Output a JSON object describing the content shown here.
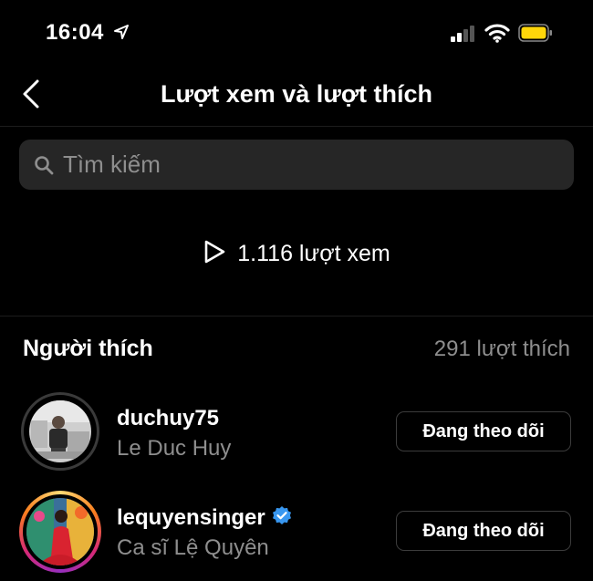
{
  "status_bar": {
    "time": "16:04"
  },
  "nav": {
    "title": "Lượt xem và lượt thích"
  },
  "search": {
    "placeholder": "Tìm kiếm"
  },
  "views": {
    "label": "1.116 lượt xem"
  },
  "likes": {
    "title": "Người thích",
    "count_label": "291 lượt thích"
  },
  "users": [
    {
      "username": "duchuy75",
      "full_name": "Le Duc Huy",
      "verified": false,
      "button_label": "Đang theo dõi"
    },
    {
      "username": "lequyensinger",
      "full_name": "Ca sĩ Lệ Quyên",
      "verified": true,
      "button_label": "Đang theo dõi"
    }
  ],
  "colors": {
    "background": "#000000",
    "secondary_text": "#8e8e8e",
    "search_bg": "#262626",
    "verified": "#3897f0",
    "battery": "#ffd60a"
  }
}
